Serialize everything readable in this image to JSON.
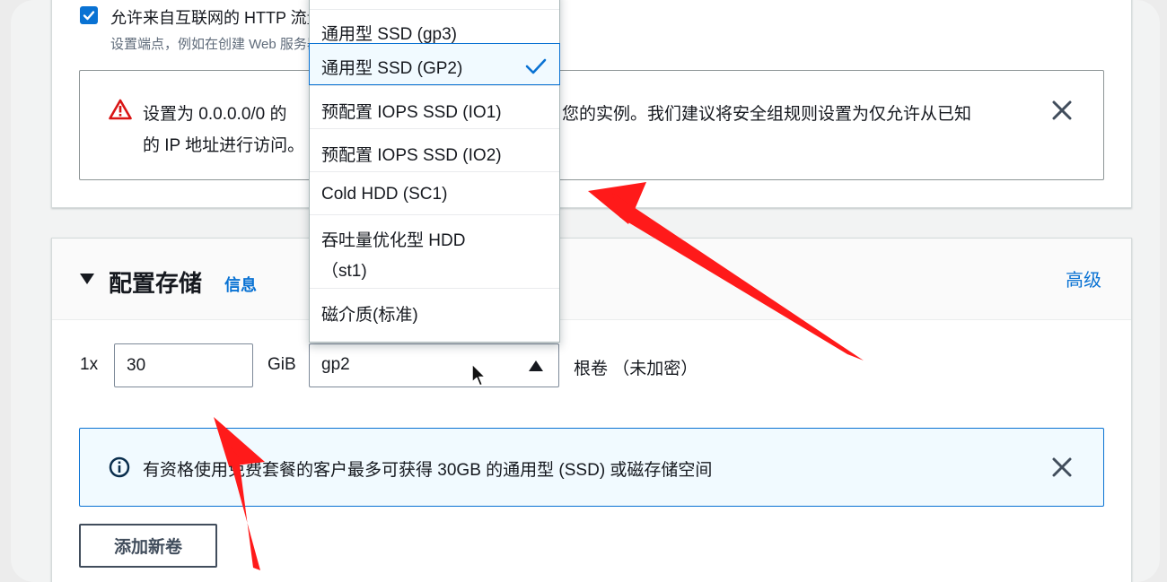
{
  "network": {
    "http_checkbox_label": "允许来自互联网的 HTTP 流量",
    "http_checkbox_desc": "设置端点，例如在创建 Web 服务器时",
    "warning_line1_start": "设置为 0.0.0.0/0 的",
    "warning_line1_end": "您的实例。我们建议将安全组规则设置为仅允许从已知",
    "warning_line2": "的 IP 地址进行访问。"
  },
  "storage": {
    "title": "配置存储",
    "info_link": "信息",
    "advanced_link": "高级",
    "quantity_label": "1x",
    "size_value": "30",
    "unit_label": "GiB",
    "volume_type_selected": "gp2",
    "root_label": "根卷  （未加密）",
    "free_tier_info": "有资格使用免费套餐的客户最多可获得 30GB 的通用型 (SSD) 或磁存储空间",
    "add_volume_button": "添加新卷"
  },
  "dropdown": {
    "options": [
      {
        "label": "通用型 SSD (gp3)"
      },
      {
        "label": "通用型 SSD (GP2)",
        "selected": true
      },
      {
        "label": "预配置 IOPS SSD (IO1)"
      },
      {
        "label": "预配置 IOPS SSD (IO2)"
      },
      {
        "label": "Cold HDD (SC1)"
      },
      {
        "label_line1": "吞吐量优化型 HDD",
        "label_line2": "（st1)"
      },
      {
        "label": "磁介质(标准)"
      }
    ]
  },
  "colors": {
    "accent": "#0972d3",
    "warning": "#d91515",
    "annotation_arrow": "#ff1a1a"
  }
}
